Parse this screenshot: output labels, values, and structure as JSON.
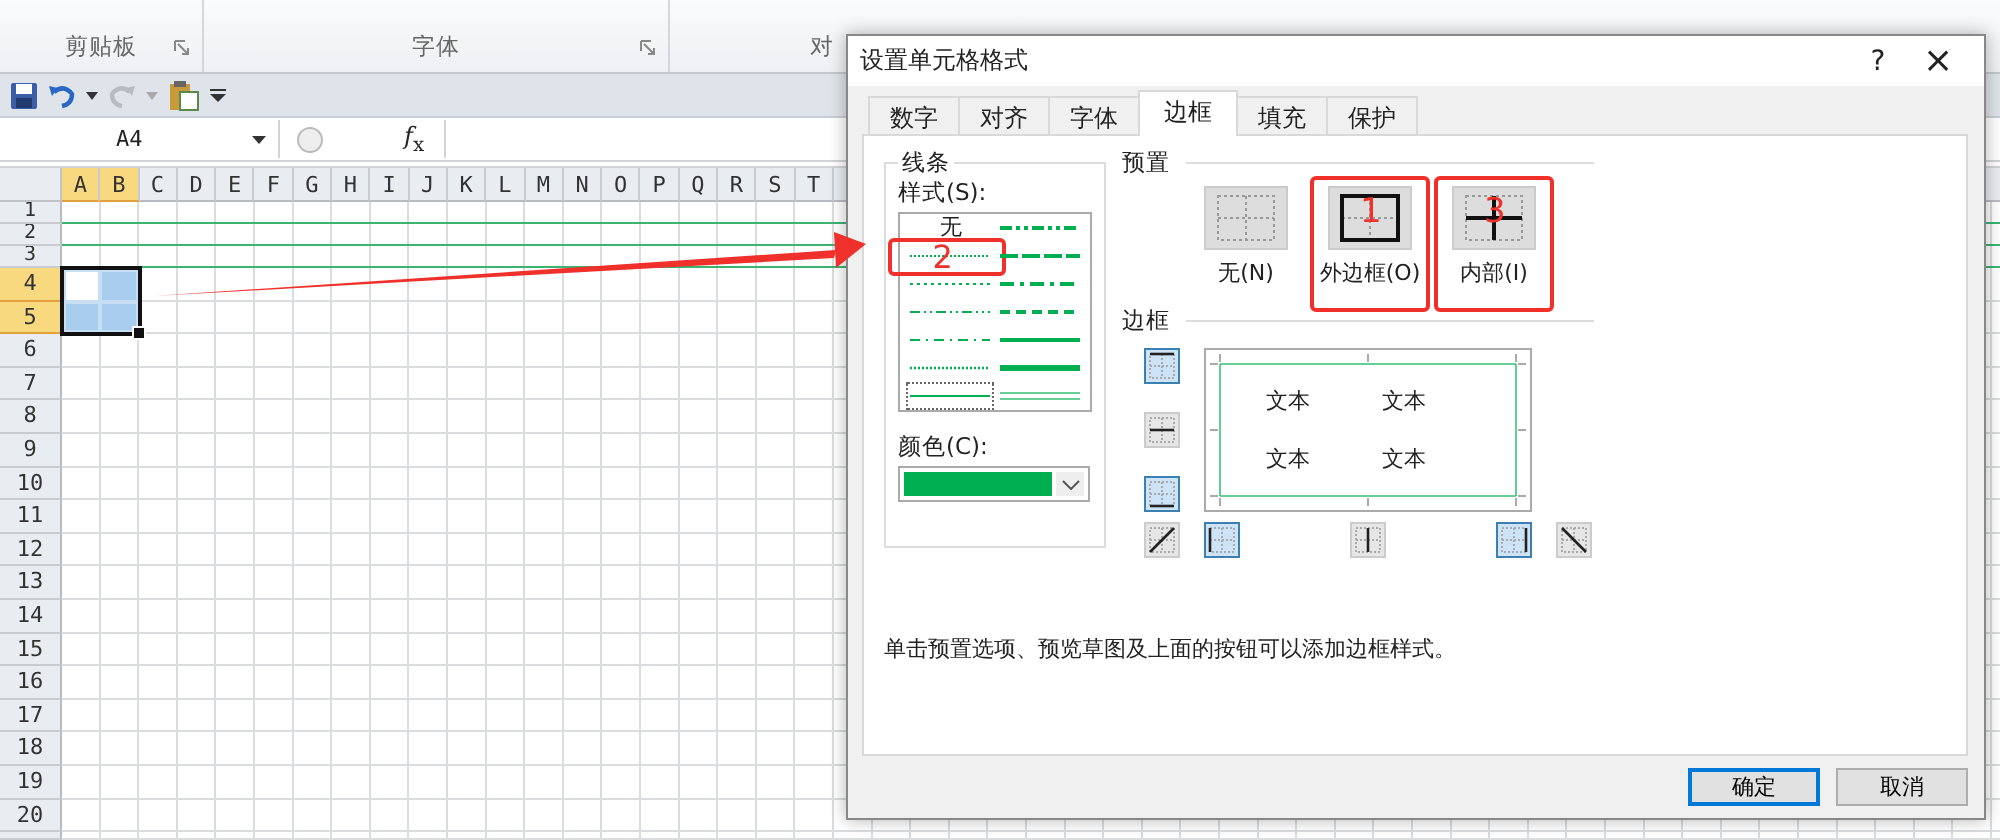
{
  "ribbon": {
    "groups": [
      {
        "label": "剪贴板",
        "launcher": true
      },
      {
        "label": "字体",
        "launcher": true
      },
      {
        "label": "对",
        "launcher": false
      }
    ]
  },
  "name_box": {
    "value": "A4"
  },
  "formula_bar": {
    "label": "*f*$_{x}$"
  },
  "sheet": {
    "columns": [
      {
        "label": "A",
        "selected": true
      },
      {
        "label": "B",
        "selected": true
      },
      {
        "label": "C",
        "selected": false
      },
      {
        "label": "D",
        "selected": false
      },
      {
        "label": "E",
        "selected": false
      },
      {
        "label": "F",
        "selected": false
      },
      {
        "label": "G",
        "selected": false
      },
      {
        "label": "H",
        "selected": false
      },
      {
        "label": "I",
        "selected": false
      },
      {
        "label": "J",
        "selected": false
      },
      {
        "label": "K",
        "selected": false
      },
      {
        "label": "L",
        "selected": false
      },
      {
        "label": "M",
        "selected": false
      },
      {
        "label": "N",
        "selected": false
      },
      {
        "label": "O",
        "selected": false
      },
      {
        "label": "P",
        "selected": false
      },
      {
        "label": "Q",
        "selected": false
      },
      {
        "label": "R",
        "selected": false
      },
      {
        "label": "S",
        "selected": false
      },
      {
        "label": "T",
        "selected": false
      }
    ],
    "rows": [
      {
        "label": "1",
        "kind": "short",
        "selected": false,
        "border_bottom": true
      },
      {
        "label": "2",
        "kind": "short",
        "selected": false,
        "border_bottom": true
      },
      {
        "label": "3",
        "kind": "short",
        "selected": false,
        "border_bottom": true
      },
      {
        "label": "4",
        "kind": "normal",
        "selected": true,
        "border_bottom": false
      },
      {
        "label": "5",
        "kind": "normal",
        "selected": true,
        "border_bottom": false
      },
      {
        "label": "6",
        "kind": "normal",
        "selected": false,
        "border_bottom": false
      },
      {
        "label": "7",
        "kind": "normal",
        "selected": false,
        "border_bottom": false
      },
      {
        "label": "8",
        "kind": "normal",
        "selected": false,
        "border_bottom": false
      },
      {
        "label": "9",
        "kind": "normal",
        "selected": false,
        "border_bottom": false
      },
      {
        "label": "10",
        "kind": "normal",
        "selected": false,
        "border_bottom": false
      },
      {
        "label": "11",
        "kind": "normal",
        "selected": false,
        "border_bottom": false
      },
      {
        "label": "12",
        "kind": "normal",
        "selected": false,
        "border_bottom": false
      },
      {
        "label": "13",
        "kind": "normal",
        "selected": false,
        "border_bottom": false
      },
      {
        "label": "14",
        "kind": "normal",
        "selected": false,
        "border_bottom": false
      },
      {
        "label": "15",
        "kind": "normal",
        "selected": false,
        "border_bottom": false
      },
      {
        "label": "16",
        "kind": "normal",
        "selected": false,
        "border_bottom": false
      },
      {
        "label": "17",
        "kind": "normal",
        "selected": false,
        "border_bottom": false
      },
      {
        "label": "18",
        "kind": "normal",
        "selected": false,
        "border_bottom": false
      },
      {
        "label": "19",
        "kind": "normal",
        "selected": false,
        "border_bottom": false
      },
      {
        "label": "20",
        "kind": "normal",
        "selected": false,
        "border_bottom": false
      }
    ]
  },
  "dialog": {
    "title": "设置单元格格式",
    "help": "?",
    "close": "×",
    "tabs": [
      {
        "label": "数字",
        "selected": false
      },
      {
        "label": "对齐",
        "selected": false
      },
      {
        "label": "字体",
        "selected": false
      },
      {
        "label": "边框",
        "selected": true
      },
      {
        "label": "填充",
        "selected": false
      },
      {
        "label": "保护",
        "selected": false
      }
    ],
    "line_group": {
      "title": "线条",
      "style_label": "样式(S):",
      "color_label": "颜色(C):",
      "color": "#00b050",
      "styles": [
        {
          "kind": "none",
          "label": "无",
          "selected": false
        },
        {
          "kind": "hair",
          "selected": false,
          "annotation": "2"
        },
        {
          "kind": "dotted",
          "selected": false
        },
        {
          "kind": "dash_dot_dot_thin",
          "selected": false
        },
        {
          "kind": "dash_dot_thin",
          "selected": false
        },
        {
          "kind": "fine_dotted",
          "selected": false
        },
        {
          "kind": "thin",
          "selected": true
        },
        {
          "kind": "dash_dot_dot_medium",
          "selected": false
        },
        {
          "kind": "long_dash_medium",
          "selected": false
        },
        {
          "kind": "dash_dot_medium",
          "selected": false
        },
        {
          "kind": "dashed_medium",
          "selected": false
        },
        {
          "kind": "medium",
          "selected": false
        },
        {
          "kind": "thick",
          "selected": false
        },
        {
          "kind": "double",
          "selected": false
        }
      ]
    },
    "presets": {
      "title": "预置",
      "items": [
        {
          "kind": "none",
          "label": "无(N)"
        },
        {
          "kind": "outline",
          "label": "外边框(O)",
          "annotation": "1"
        },
        {
          "kind": "inside",
          "label": "内部(I)",
          "annotation": "3"
        }
      ]
    },
    "borders": {
      "title": "边框",
      "preview_text": [
        "文本",
        "文本",
        "文本",
        "文本"
      ],
      "buttons": [
        {
          "kind": "top",
          "on": true
        },
        {
          "kind": "middle_h",
          "on": false
        },
        {
          "kind": "bottom",
          "on": true
        },
        {
          "kind": "diag_up",
          "on": false
        },
        {
          "kind": "left",
          "on": true
        },
        {
          "kind": "middle_v",
          "on": false
        },
        {
          "kind": "right",
          "on": true
        },
        {
          "kind": "diag_down",
          "on": false
        }
      ]
    },
    "hint": "单击预置选项、预览草图及上面的按钮可以添加边框样式。",
    "buttons": [
      {
        "label": "确定",
        "default": true
      },
      {
        "label": "取消",
        "default": false
      }
    ]
  }
}
